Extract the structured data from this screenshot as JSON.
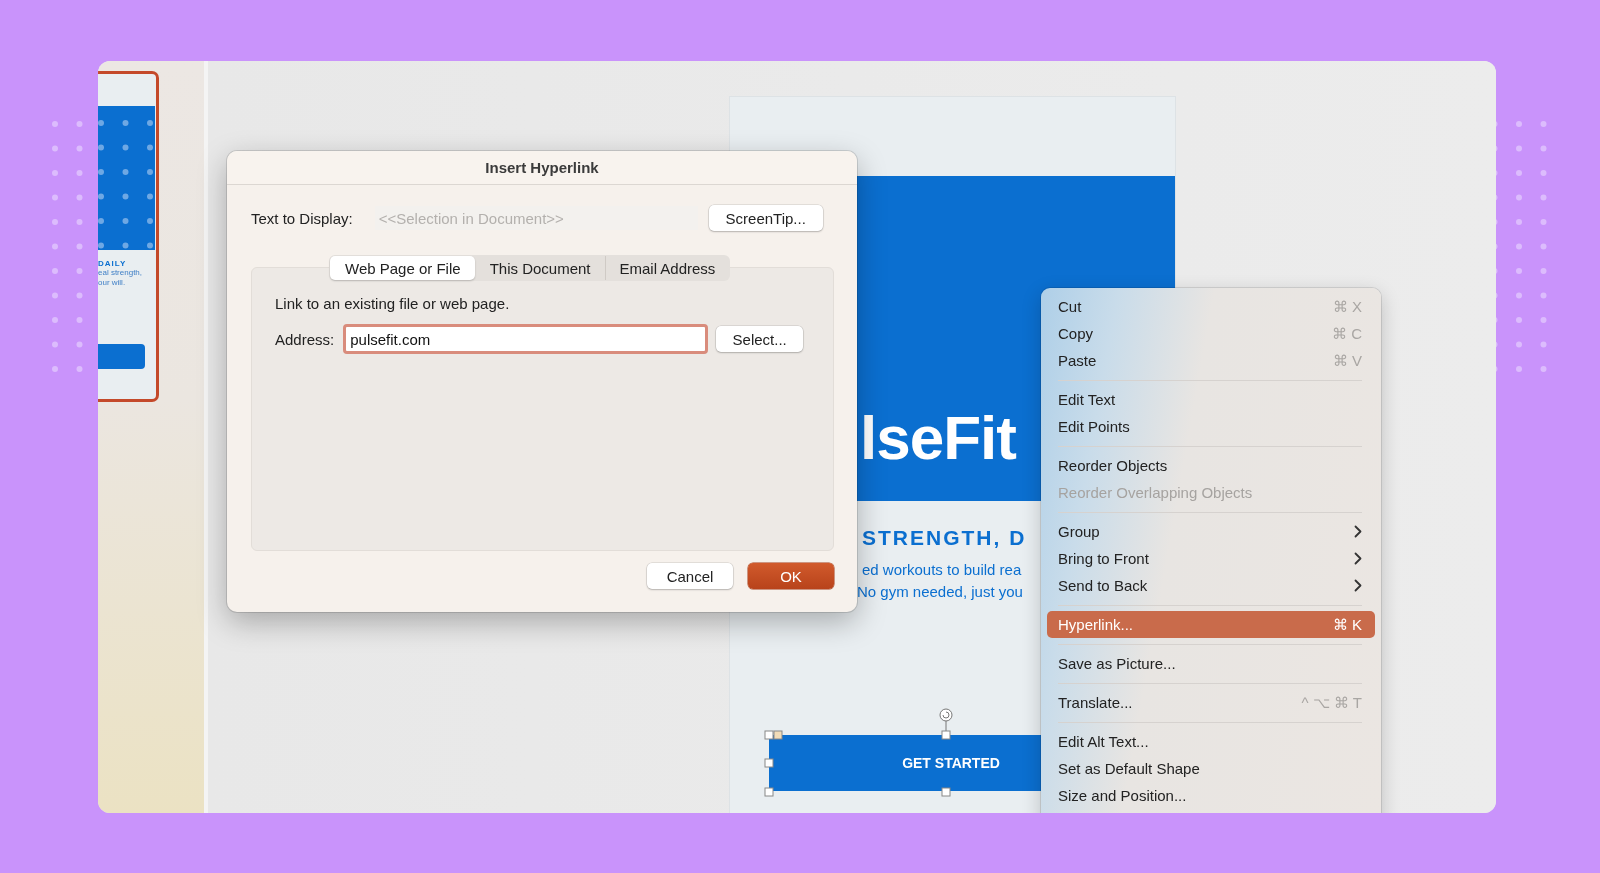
{
  "thumbnail": {
    "selected": true,
    "heading": "DAILY",
    "lines": [
      "eal strength,",
      "our will."
    ]
  },
  "slide": {
    "title": "lseFit",
    "tagline": "STRENGTH, D",
    "body": [
      "ed workouts to build rea",
      "No gym needed, just you"
    ],
    "button": {
      "label": "GET STARTED",
      "selected": true
    }
  },
  "dialog": {
    "title": "Insert Hyperlink",
    "text_to_display": {
      "label": "Text to Display:",
      "placeholder": "<<Selection in Document>>"
    },
    "screentip": "ScreenTip...",
    "tabs": [
      {
        "label": "Web Page or File",
        "selected": true
      },
      {
        "label": "This Document",
        "selected": false
      },
      {
        "label": "Email Address",
        "selected": false
      }
    ],
    "hint": "Link to an existing file or web page.",
    "address": {
      "label": "Address:",
      "value": "pulsefit.com"
    },
    "select": "Select...",
    "buttons": [
      {
        "label": "Cancel",
        "kind": "secondary"
      },
      {
        "label": "OK",
        "kind": "primary"
      }
    ]
  },
  "context_menu": {
    "items": [
      {
        "kind": "item",
        "label": "Cut",
        "shortcut": "⌘ X",
        "submenu": false,
        "disabled": false,
        "selected": false
      },
      {
        "kind": "item",
        "label": "Copy",
        "shortcut": "⌘ C",
        "submenu": false,
        "disabled": false,
        "selected": false
      },
      {
        "kind": "item",
        "label": "Paste",
        "shortcut": "⌘ V",
        "submenu": false,
        "disabled": false,
        "selected": false
      },
      {
        "kind": "separator"
      },
      {
        "kind": "item",
        "label": "Edit Text",
        "submenu": false,
        "disabled": false,
        "selected": false
      },
      {
        "kind": "item",
        "label": "Edit Points",
        "submenu": false,
        "disabled": false,
        "selected": false
      },
      {
        "kind": "separator"
      },
      {
        "kind": "item",
        "label": "Reorder Objects",
        "submenu": false,
        "disabled": false,
        "selected": false
      },
      {
        "kind": "item",
        "label": "Reorder Overlapping Objects",
        "submenu": false,
        "disabled": true,
        "selected": false
      },
      {
        "kind": "separator"
      },
      {
        "kind": "item",
        "label": "Group",
        "submenu": true,
        "disabled": false,
        "selected": false
      },
      {
        "kind": "item",
        "label": "Bring to Front",
        "submenu": true,
        "disabled": false,
        "selected": false
      },
      {
        "kind": "item",
        "label": "Send to Back",
        "submenu": true,
        "disabled": false,
        "selected": false
      },
      {
        "kind": "separator"
      },
      {
        "kind": "item",
        "label": "Hyperlink...",
        "shortcut": "⌘ K",
        "submenu": false,
        "disabled": false,
        "selected": true
      },
      {
        "kind": "separator"
      },
      {
        "kind": "item",
        "label": "Save as Picture...",
        "submenu": false,
        "disabled": false,
        "selected": false
      },
      {
        "kind": "separator"
      },
      {
        "kind": "item",
        "label": "Translate...",
        "shortcut": "^ ⌥ ⌘ T",
        "submenu": false,
        "disabled": false,
        "selected": false
      },
      {
        "kind": "separator"
      },
      {
        "kind": "item",
        "label": "Edit Alt Text...",
        "submenu": false,
        "disabled": false,
        "selected": false
      },
      {
        "kind": "item",
        "label": "Set as Default Shape",
        "submenu": false,
        "disabled": false,
        "selected": false
      },
      {
        "kind": "item",
        "label": "Size and Position...",
        "submenu": false,
        "disabled": false,
        "selected": false
      }
    ]
  }
}
